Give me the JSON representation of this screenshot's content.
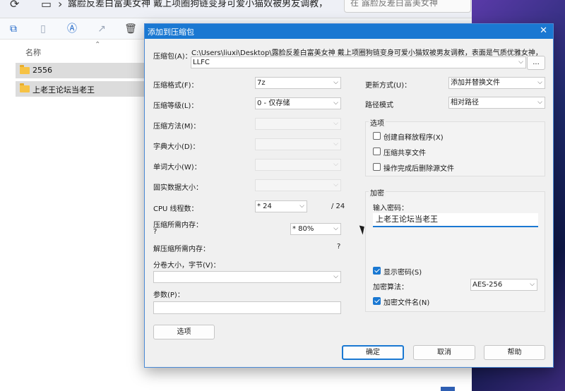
{
  "explorer": {
    "path_text": "露脸反差白富美女神 戴上项圈狗链变身可爱小猫奴被男友调教，",
    "search_placeholder": "在 露脸反差白富美女神",
    "column_name": "名称",
    "rows": [
      {
        "name": "2556"
      },
      {
        "name": "上老王论坛当老王"
      }
    ]
  },
  "dialog": {
    "title": "添加到压缩包",
    "archive": {
      "label": "压缩包(A)：",
      "path": "C:\\Users\\liuxi\\Desktop\\露脸反差白富美女神 戴上项圈狗链变身可爱小猫奴被男友调教，表面是气质优雅女神，",
      "value": "LLFC",
      "browse": "..."
    },
    "left": {
      "format_label": "压缩格式(F)：",
      "format_value": "7z",
      "level_label": "压缩等级(L)：",
      "level_value": "0 - 仅存储",
      "method_label": "压缩方法(M)：",
      "dict_label": "字典大小(D)：",
      "word_label": "单词大小(W)：",
      "solid_label": "固实数据大小：",
      "cpu_label": "CPU 线程数：",
      "cpu_value": "* 24",
      "cpu_total": "/ 24",
      "mem_label": "压缩所需内存：",
      "mem_q": "?",
      "mem_value": "* 80%",
      "decomp_label": "解压缩所需内存：",
      "decomp_q": "?",
      "split_label": "分卷大小，字节(V)：",
      "split_value": "",
      "params_label": "参数(P)：",
      "params_value": "",
      "options_btn": "选项"
    },
    "right": {
      "update_label": "更新方式(U)：",
      "update_value": "添加并替换文件",
      "pathmode_label": "路径模式",
      "pathmode_value": "相对路径",
      "options_group": "选项",
      "opt_sfx": "创建自释放程序(X)",
      "opt_shared": "压缩共享文件",
      "opt_delete": "操作完成后删除源文件",
      "encrypt_group": "加密",
      "pwd_label": "输入密码：",
      "pwd_value": "上老王论坛当老王",
      "show_pwd": "显示密码(S)",
      "method_label": "加密算法：",
      "method_value": "AES-256",
      "encrypt_names": "加密文件名(N)"
    },
    "buttons": {
      "ok": "确定",
      "cancel": "取消",
      "help": "帮助"
    }
  }
}
